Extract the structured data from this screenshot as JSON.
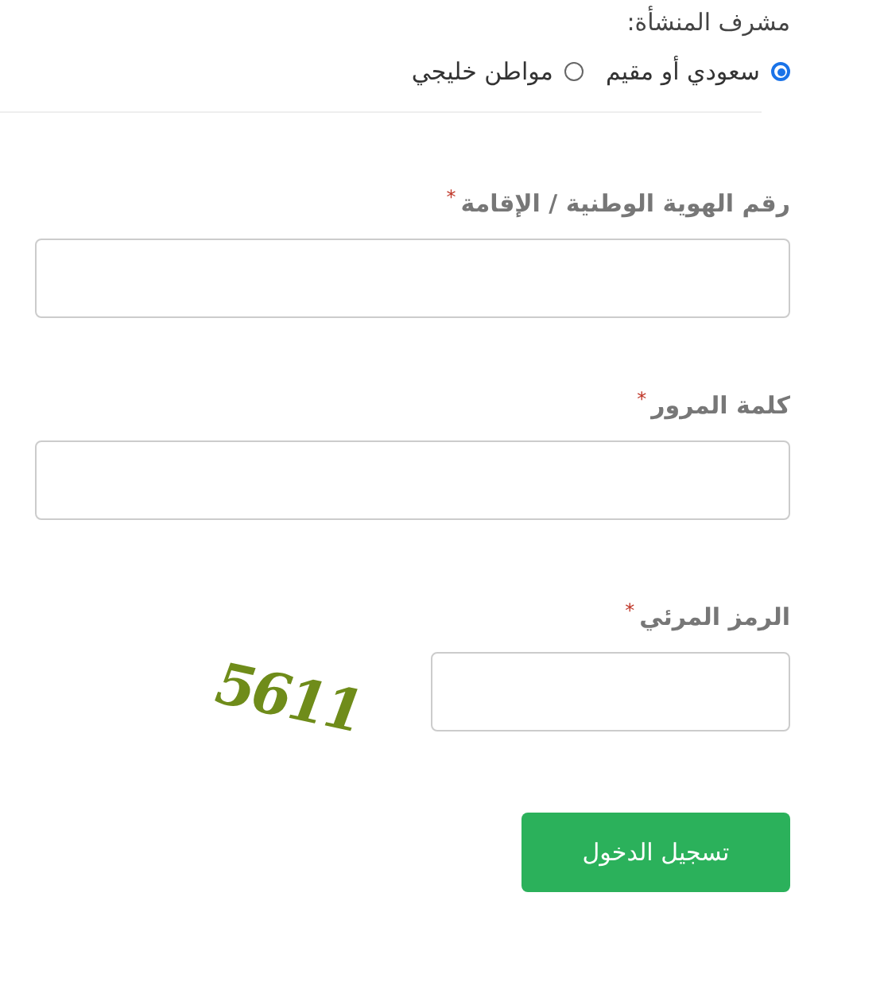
{
  "owner": {
    "label": "مشرف المنشأة:",
    "options": [
      {
        "label": "سعودي أو مقيم",
        "selected": true
      },
      {
        "label": "مواطن خليجي",
        "selected": false
      }
    ]
  },
  "fields": [
    {
      "kind": "text",
      "label": "رقم الهوية الوطنية / الإقامة",
      "required_mark": "*"
    },
    {
      "kind": "password",
      "label": "كلمة المرور",
      "required_mark": "*"
    },
    {
      "kind": "captcha",
      "label": "الرمز المرئي",
      "required_mark": "*",
      "captcha": "5611"
    }
  ],
  "submit": "تسجيل الدخول"
}
